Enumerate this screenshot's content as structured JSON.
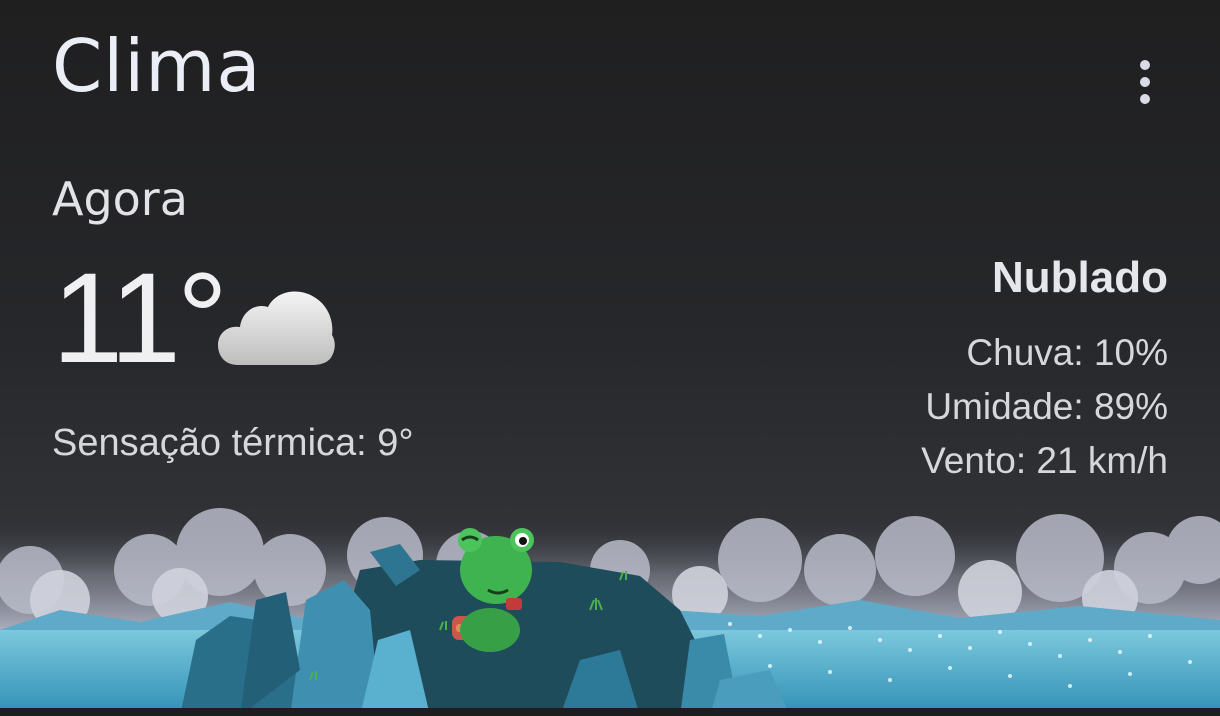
{
  "app": {
    "title": "Clima",
    "menu_icon": "more-vert-icon"
  },
  "current": {
    "section_label": "Agora",
    "temperature": "11°",
    "condition_icon": "cloud-icon",
    "feels_like": "Sensação térmica: 9°",
    "condition": "Nublado",
    "stats": {
      "rain": "Chuva: 10%",
      "humidity": "Umidade: 89%",
      "wind": "Vento: 21 km/h"
    }
  },
  "colors": {
    "background_top": "#1f1f20",
    "background_bottom": "#3a3d44",
    "text_primary": "#eceef7",
    "frog_green": "#3fb34f",
    "rock_blue": "#2a6f8a",
    "water": "#58b8d3"
  }
}
